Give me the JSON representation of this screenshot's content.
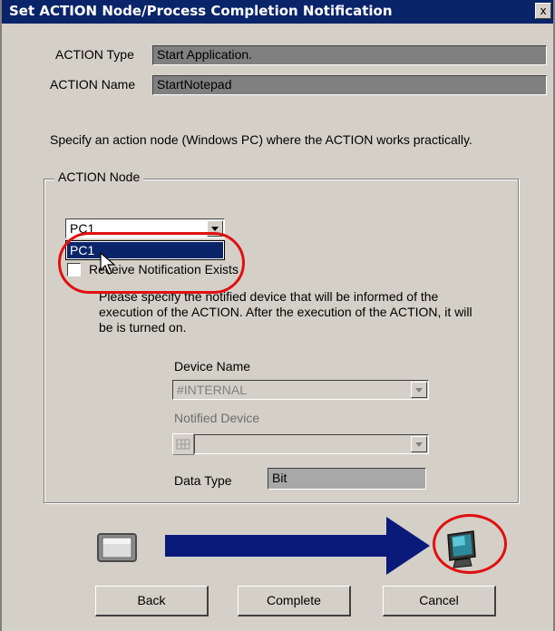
{
  "window": {
    "title": "Set ACTION Node/Process Completion Notification",
    "close_glyph": "x"
  },
  "action_type": {
    "label": "ACTION Type",
    "value": "Start Application."
  },
  "action_name": {
    "label": "ACTION Name",
    "value": "StartNotepad"
  },
  "instruction": "Specify an action node (Windows PC) where the ACTION works practically.",
  "action_node": {
    "group_title": "ACTION Node",
    "combo_value": "PC1",
    "dropdown_options": [
      "PC1"
    ],
    "receive_notification_label": "Receive Notification Exists",
    "receive_notification_checked": false,
    "description": "Please specify the notified device that will be informed of the execution of the ACTION. After the execution of the ACTION, it will be is turned on.",
    "device_name_label": "Device Name",
    "device_name_value": "#INTERNAL",
    "notified_device_label": "Notified Device",
    "notified_device_value": "",
    "data_type_label": "Data Type",
    "data_type_value": "Bit"
  },
  "buttons": {
    "back": "Back",
    "complete": "Complete",
    "cancel": "Cancel"
  },
  "icons": {
    "source": "display-panel-icon",
    "target": "pc-monitor-icon",
    "flow": "arrow-right-icon",
    "cursor": "mouse-pointer-icon"
  },
  "colors": {
    "titlebar": "#0a246a",
    "highlight": "#e01010",
    "arrow": "#0a1a7a"
  }
}
